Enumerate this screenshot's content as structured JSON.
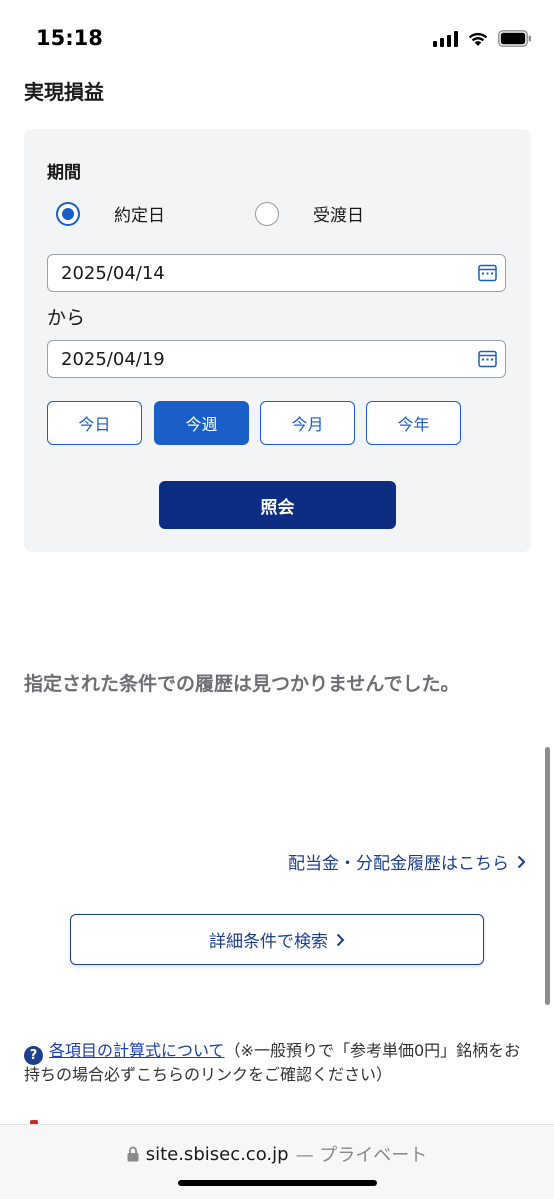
{
  "status": {
    "time": "15:18"
  },
  "page": {
    "title": "実現損益"
  },
  "form": {
    "period_label": "期間",
    "radios": [
      {
        "label": "約定日",
        "checked": true
      },
      {
        "label": "受渡日",
        "checked": false
      }
    ],
    "from_date": "2025/04/14",
    "separator": "から",
    "to_date": "2025/04/19",
    "range_buttons": [
      {
        "label": "今日",
        "active": false
      },
      {
        "label": "今週",
        "active": true
      },
      {
        "label": "今月",
        "active": false
      },
      {
        "label": "今年",
        "active": false
      }
    ],
    "submit_label": "照会"
  },
  "results": {
    "empty_message": "指定された条件での履歴は見つかりませんでした。"
  },
  "links": {
    "dividend_history": "配当金・分配金履歴はこちら",
    "detail_search": "詳細条件で検索"
  },
  "note": {
    "link_text": "各項目の計算式について",
    "text": "（※一般預りで「参考単価0円」銘柄をお持ちの場合必ずこちらのリンクをご確認ください）"
  },
  "browser": {
    "domain": "site.sbisec.co.jp",
    "suffix": "— プライベート"
  },
  "colors": {
    "accent": "#1a5fc7",
    "primary_button": "#0c2d82",
    "link": "#1d3f8f",
    "panel_bg": "#f3f4f6"
  }
}
